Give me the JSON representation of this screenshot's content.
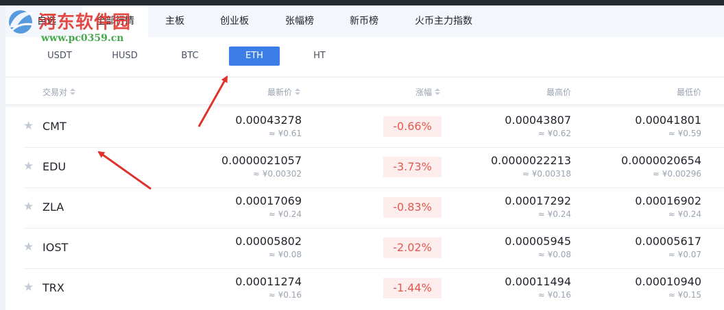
{
  "watermark": {
    "title": "河东软件园",
    "url": "www.pc0359.cn"
  },
  "category_tabs": [
    {
      "label": "自选"
    },
    {
      "label": "全部行情"
    },
    {
      "label": "主板"
    },
    {
      "label": "创业板"
    },
    {
      "label": "张幅榜"
    },
    {
      "label": "新币榜"
    },
    {
      "label": "火币主力指数"
    }
  ],
  "quote_tabs": [
    {
      "label": "USDT"
    },
    {
      "label": "HUSD"
    },
    {
      "label": "BTC"
    },
    {
      "label": "ETH",
      "active": true
    },
    {
      "label": "HT"
    }
  ],
  "table": {
    "headers": {
      "pair": "交易对",
      "last": "最新价",
      "change": "涨幅",
      "high": "最高价",
      "low": "最低价"
    },
    "rows": [
      {
        "symbol": "CMT",
        "last": "0.00043278",
        "last_cny": "≈ ¥0.61",
        "change": "-0.66%",
        "high": "0.00043807",
        "high_cny": "≈ ¥0.62",
        "low": "0.00041801",
        "low_cny": "≈ ¥0.59"
      },
      {
        "symbol": "EDU",
        "last": "0.0000021057",
        "last_cny": "≈ ¥0.00302",
        "change": "-3.73%",
        "high": "0.0000022213",
        "high_cny": "≈ ¥0.00318",
        "low": "0.0000020654",
        "low_cny": "≈ ¥0.00296"
      },
      {
        "symbol": "ZLA",
        "last": "0.00017069",
        "last_cny": "≈ ¥0.24",
        "change": "-0.83%",
        "high": "0.00017292",
        "high_cny": "≈ ¥0.24",
        "low": "0.00016902",
        "low_cny": "≈ ¥0.24"
      },
      {
        "symbol": "IOST",
        "last": "0.00005802",
        "last_cny": "≈ ¥0.08",
        "change": "-2.02%",
        "high": "0.00005945",
        "high_cny": "≈ ¥0.08",
        "low": "0.00005617",
        "low_cny": "≈ ¥0.07"
      },
      {
        "symbol": "TRX",
        "last": "0.00011274",
        "last_cny": "≈ ¥0.16",
        "change": "-1.44%",
        "high": "0.00011494",
        "high_cny": "≈ ¥0.16",
        "low": "0.00010940",
        "low_cny": "≈ ¥0.15"
      }
    ]
  },
  "colors": {
    "accent": "#3b7ee8",
    "negative": "#e2584f",
    "negative_bg": "#fdeeed",
    "annotation": "#e0322b"
  }
}
